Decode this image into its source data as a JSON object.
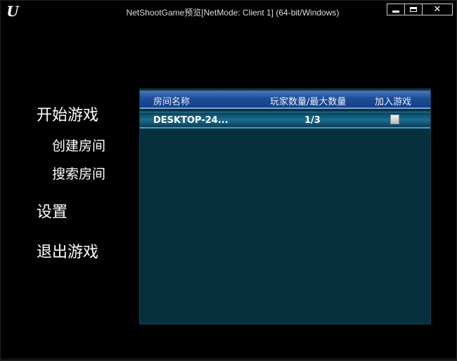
{
  "window": {
    "title": "NetShootGame预览[NetMode: Client 1]  (64-bit/Windows)",
    "logo_letter": "U",
    "close_symbol": "✕"
  },
  "menu": {
    "start_game": "开始游戏",
    "create_room": "创建房间",
    "search_room": "搜索房间",
    "settings": "设置",
    "exit_game": "退出游戏"
  },
  "server_list": {
    "headers": {
      "room_name": "房间名称",
      "players": "玩家数量/最大数量",
      "join": "加入游戏"
    },
    "rows": [
      {
        "room_name": "DESKTOP-24...",
        "players": "1/3",
        "join_checked": false
      }
    ]
  },
  "colors": {
    "header_blue": "#1e4f9c",
    "panel_bg": "#07303f",
    "row_highlight": "#1a6f8f"
  }
}
